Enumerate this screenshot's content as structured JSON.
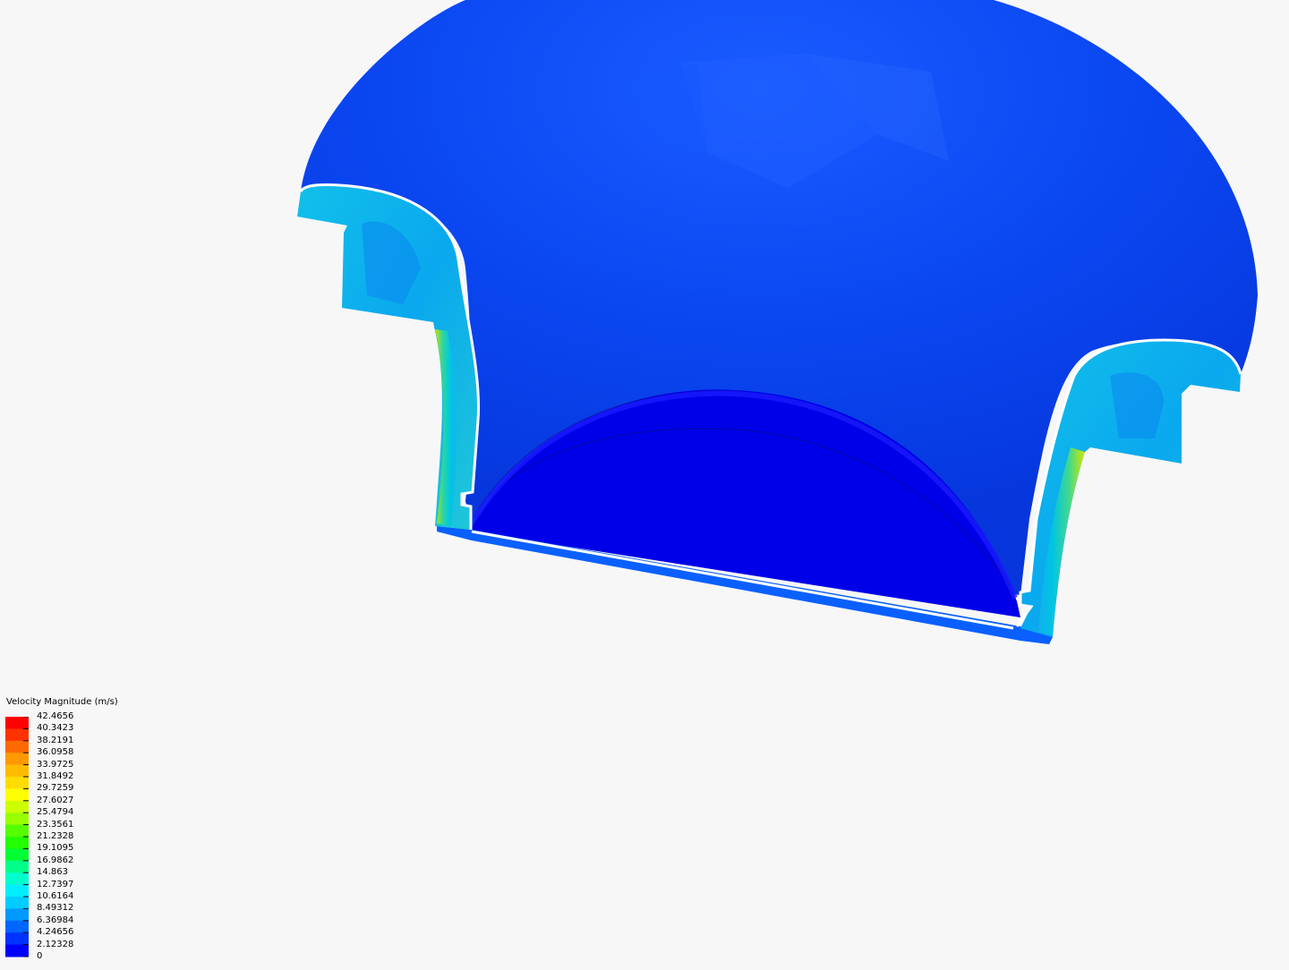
{
  "legend": {
    "title": "Velocity Magnitude (m/s)",
    "labels": [
      "42.4656",
      "40.3423",
      "38.2191",
      "36.0958",
      "33.9725",
      "31.8492",
      "29.7259",
      "27.6027",
      "25.4794",
      "23.3561",
      "21.2328",
      "19.1095",
      "16.9862",
      "14.863",
      "12.7397",
      "10.6164",
      "8.49312",
      "6.36984",
      "4.24656",
      "2.12328",
      "0"
    ],
    "colors": [
      "#ff0000",
      "#ff3300",
      "#ff6a00",
      "#ff9900",
      "#ffbb00",
      "#ffdd00",
      "#ffff00",
      "#ccff00",
      "#99ff00",
      "#55ff00",
      "#22ff00",
      "#00ff33",
      "#00ff88",
      "#00ffcc",
      "#00eeff",
      "#00ccff",
      "#0099ff",
      "#0066ff",
      "#0033ff",
      "#0000ff"
    ]
  },
  "scene": {
    "background_color": "#f7f7f7",
    "dome_color": "#0a3ff0",
    "floor_color": "#0000e6",
    "outline_color": "#ffffff"
  }
}
